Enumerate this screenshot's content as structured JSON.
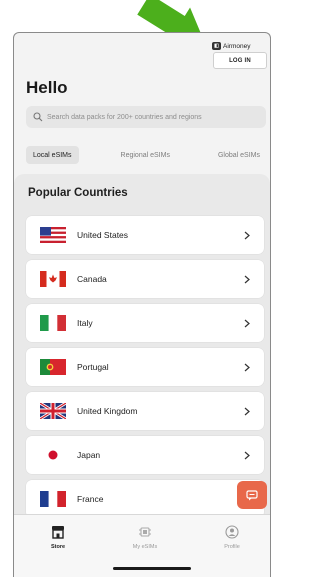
{
  "brand": {
    "name": "Airmoney",
    "icon": "airmoney-logo-icon"
  },
  "header": {
    "login_label": "LOG IN",
    "greeting": "Hello"
  },
  "search": {
    "placeholder": "Search data packs for 200+ countries and regions",
    "icon": "search-icon"
  },
  "tabs": [
    {
      "label": "Local eSIMs",
      "active": true
    },
    {
      "label": "Regional eSIMs",
      "active": false
    },
    {
      "label": "Global eSIMs",
      "active": false
    }
  ],
  "popular": {
    "title": "Popular Countries",
    "countries": [
      {
        "name": "United States",
        "flag": "us-flag-icon"
      },
      {
        "name": "Canada",
        "flag": "canada-flag-icon"
      },
      {
        "name": "Italy",
        "flag": "italy-flag-icon"
      },
      {
        "name": "Portugal",
        "flag": "portugal-flag-icon"
      },
      {
        "name": "United Kingdom",
        "flag": "uk-flag-icon"
      },
      {
        "name": "Japan",
        "flag": "japan-flag-icon"
      },
      {
        "name": "France",
        "flag": "france-flag-icon"
      }
    ]
  },
  "chat": {
    "icon": "chat-icon",
    "color": "#e8684a"
  },
  "nav": {
    "items": [
      {
        "label": "Store",
        "icon": "store-icon",
        "active": true
      },
      {
        "label": "My eSIMs",
        "icon": "sim-chip-icon",
        "active": false
      },
      {
        "label": "Profile",
        "icon": "profile-icon",
        "active": false
      }
    ]
  },
  "annotation": {
    "arrow_color": "#4caf1c"
  }
}
